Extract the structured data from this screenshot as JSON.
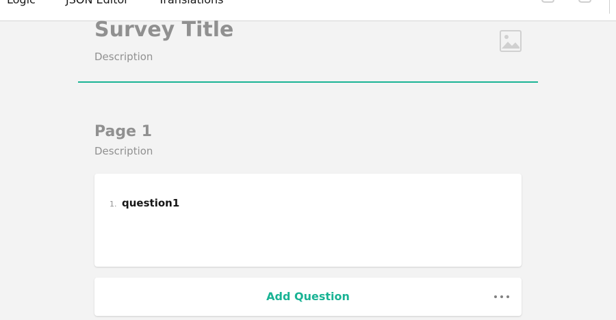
{
  "toolbar": {
    "tabs": [
      {
        "label": "Logic"
      },
      {
        "label": "JSON Editor"
      },
      {
        "label": "Translations"
      }
    ],
    "undo_icon": "undo-icon",
    "redo_icon": "redo-icon"
  },
  "survey": {
    "title": "Survey Title",
    "description": "Description",
    "logo_icon": "image-placeholder-icon"
  },
  "page": {
    "title": "Page 1",
    "description": "Description"
  },
  "questions": [
    {
      "number": "1.",
      "title": "question1"
    }
  ],
  "actions": {
    "add_question_label": "Add Question",
    "more_icon": "more-horizontal-icon"
  },
  "colors": {
    "accent": "#19b394",
    "muted_text": "#909090",
    "background": "#f3f3f3"
  }
}
